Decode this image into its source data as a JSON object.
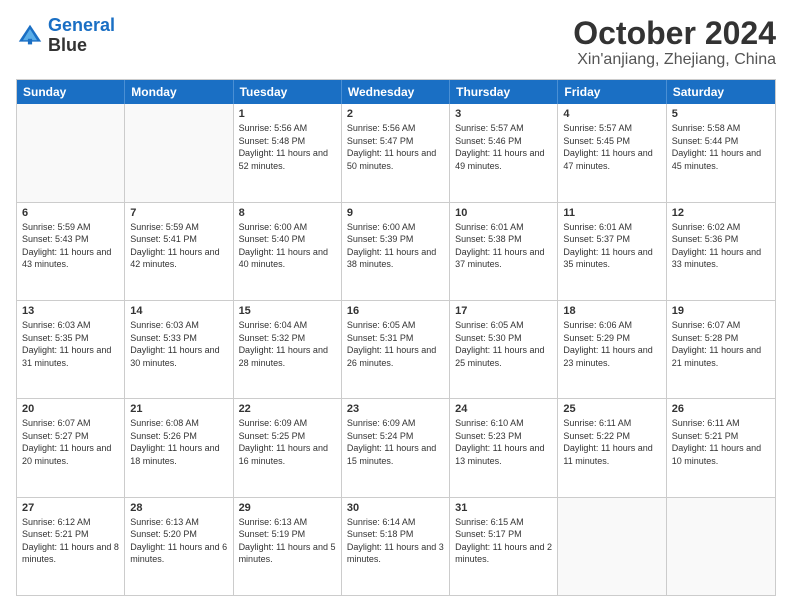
{
  "logo": {
    "line1": "General",
    "line2": "Blue"
  },
  "title": "October 2024",
  "location": "Xin'anjiang, Zhejiang, China",
  "weekdays": [
    "Sunday",
    "Monday",
    "Tuesday",
    "Wednesday",
    "Thursday",
    "Friday",
    "Saturday"
  ],
  "weeks": [
    [
      {
        "day": "",
        "content": ""
      },
      {
        "day": "",
        "content": ""
      },
      {
        "day": "1",
        "content": "Sunrise: 5:56 AM\nSunset: 5:48 PM\nDaylight: 11 hours and 52 minutes."
      },
      {
        "day": "2",
        "content": "Sunrise: 5:56 AM\nSunset: 5:47 PM\nDaylight: 11 hours and 50 minutes."
      },
      {
        "day": "3",
        "content": "Sunrise: 5:57 AM\nSunset: 5:46 PM\nDaylight: 11 hours and 49 minutes."
      },
      {
        "day": "4",
        "content": "Sunrise: 5:57 AM\nSunset: 5:45 PM\nDaylight: 11 hours and 47 minutes."
      },
      {
        "day": "5",
        "content": "Sunrise: 5:58 AM\nSunset: 5:44 PM\nDaylight: 11 hours and 45 minutes."
      }
    ],
    [
      {
        "day": "6",
        "content": "Sunrise: 5:59 AM\nSunset: 5:43 PM\nDaylight: 11 hours and 43 minutes."
      },
      {
        "day": "7",
        "content": "Sunrise: 5:59 AM\nSunset: 5:41 PM\nDaylight: 11 hours and 42 minutes."
      },
      {
        "day": "8",
        "content": "Sunrise: 6:00 AM\nSunset: 5:40 PM\nDaylight: 11 hours and 40 minutes."
      },
      {
        "day": "9",
        "content": "Sunrise: 6:00 AM\nSunset: 5:39 PM\nDaylight: 11 hours and 38 minutes."
      },
      {
        "day": "10",
        "content": "Sunrise: 6:01 AM\nSunset: 5:38 PM\nDaylight: 11 hours and 37 minutes."
      },
      {
        "day": "11",
        "content": "Sunrise: 6:01 AM\nSunset: 5:37 PM\nDaylight: 11 hours and 35 minutes."
      },
      {
        "day": "12",
        "content": "Sunrise: 6:02 AM\nSunset: 5:36 PM\nDaylight: 11 hours and 33 minutes."
      }
    ],
    [
      {
        "day": "13",
        "content": "Sunrise: 6:03 AM\nSunset: 5:35 PM\nDaylight: 11 hours and 31 minutes."
      },
      {
        "day": "14",
        "content": "Sunrise: 6:03 AM\nSunset: 5:33 PM\nDaylight: 11 hours and 30 minutes."
      },
      {
        "day": "15",
        "content": "Sunrise: 6:04 AM\nSunset: 5:32 PM\nDaylight: 11 hours and 28 minutes."
      },
      {
        "day": "16",
        "content": "Sunrise: 6:05 AM\nSunset: 5:31 PM\nDaylight: 11 hours and 26 minutes."
      },
      {
        "day": "17",
        "content": "Sunrise: 6:05 AM\nSunset: 5:30 PM\nDaylight: 11 hours and 25 minutes."
      },
      {
        "day": "18",
        "content": "Sunrise: 6:06 AM\nSunset: 5:29 PM\nDaylight: 11 hours and 23 minutes."
      },
      {
        "day": "19",
        "content": "Sunrise: 6:07 AM\nSunset: 5:28 PM\nDaylight: 11 hours and 21 minutes."
      }
    ],
    [
      {
        "day": "20",
        "content": "Sunrise: 6:07 AM\nSunset: 5:27 PM\nDaylight: 11 hours and 20 minutes."
      },
      {
        "day": "21",
        "content": "Sunrise: 6:08 AM\nSunset: 5:26 PM\nDaylight: 11 hours and 18 minutes."
      },
      {
        "day": "22",
        "content": "Sunrise: 6:09 AM\nSunset: 5:25 PM\nDaylight: 11 hours and 16 minutes."
      },
      {
        "day": "23",
        "content": "Sunrise: 6:09 AM\nSunset: 5:24 PM\nDaylight: 11 hours and 15 minutes."
      },
      {
        "day": "24",
        "content": "Sunrise: 6:10 AM\nSunset: 5:23 PM\nDaylight: 11 hours and 13 minutes."
      },
      {
        "day": "25",
        "content": "Sunrise: 6:11 AM\nSunset: 5:22 PM\nDaylight: 11 hours and 11 minutes."
      },
      {
        "day": "26",
        "content": "Sunrise: 6:11 AM\nSunset: 5:21 PM\nDaylight: 11 hours and 10 minutes."
      }
    ],
    [
      {
        "day": "27",
        "content": "Sunrise: 6:12 AM\nSunset: 5:21 PM\nDaylight: 11 hours and 8 minutes."
      },
      {
        "day": "28",
        "content": "Sunrise: 6:13 AM\nSunset: 5:20 PM\nDaylight: 11 hours and 6 minutes."
      },
      {
        "day": "29",
        "content": "Sunrise: 6:13 AM\nSunset: 5:19 PM\nDaylight: 11 hours and 5 minutes."
      },
      {
        "day": "30",
        "content": "Sunrise: 6:14 AM\nSunset: 5:18 PM\nDaylight: 11 hours and 3 minutes."
      },
      {
        "day": "31",
        "content": "Sunrise: 6:15 AM\nSunset: 5:17 PM\nDaylight: 11 hours and 2 minutes."
      },
      {
        "day": "",
        "content": ""
      },
      {
        "day": "",
        "content": ""
      }
    ]
  ]
}
